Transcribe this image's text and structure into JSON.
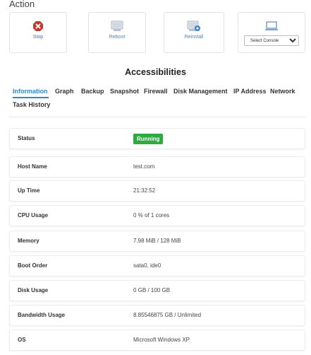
{
  "action": {
    "title": "Action",
    "buttons": [
      {
        "label": "Stop",
        "icon": "stop-icon"
      },
      {
        "label": "Reboot",
        "icon": "reboot-icon"
      },
      {
        "label": "Reinstall",
        "icon": "reinstall-icon"
      }
    ],
    "console": {
      "icon": "monitor-icon",
      "placeholder": "Select Console"
    }
  },
  "accessibilities": {
    "title": "Accessibilities",
    "tabs": [
      {
        "label": "Information",
        "active": true
      },
      {
        "label": "Graph"
      },
      {
        "label": "Backup"
      },
      {
        "label": "Snapshot"
      },
      {
        "label": "Firewall"
      },
      {
        "label": "Disk Management"
      },
      {
        "label": "IP Address"
      },
      {
        "label": "Network"
      },
      {
        "label": "Task History"
      }
    ]
  },
  "info": [
    {
      "key": "Status",
      "value": "Running"
    },
    {
      "key": "Host Name",
      "value": "test.com"
    },
    {
      "key": "Up Time",
      "value": "21:32:52"
    },
    {
      "key": "CPU Usage",
      "value": "0 % of 1 cores"
    },
    {
      "key": "Memory",
      "value": "7.98 MiB / 128 MiB"
    },
    {
      "key": "Boot Order",
      "value": "sata0, ide0"
    },
    {
      "key": "Disk Usage",
      "value": "0 GB / 100 GB"
    },
    {
      "key": "Bandwidth Usage",
      "value": "8.85546875 GB / Unlimited"
    },
    {
      "key": "OS",
      "value": "Microsoft Windows XP"
    }
  ],
  "colors": {
    "accent": "#2a8ad0",
    "running": "#2eaa3f",
    "stop": "#c0392b"
  }
}
